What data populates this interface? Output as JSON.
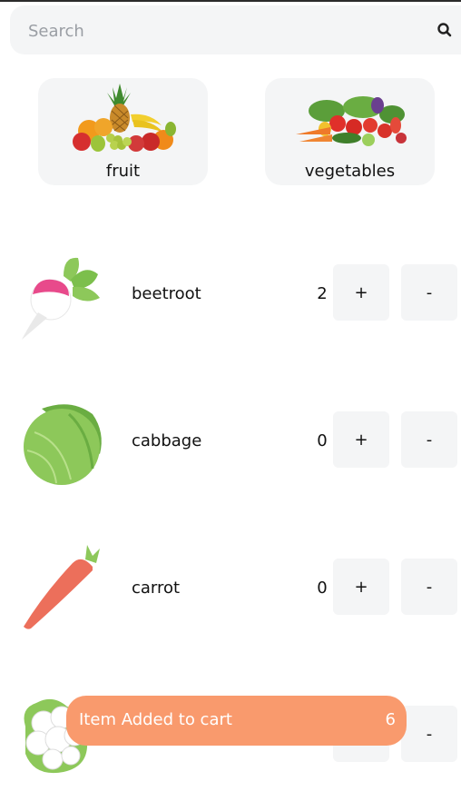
{
  "search": {
    "placeholder": "Search",
    "value": ""
  },
  "categories": [
    {
      "label": "fruit",
      "icon": "fruit-basket-image"
    },
    {
      "label": "vegetables",
      "icon": "vegetables-basket-image"
    }
  ],
  "items": [
    {
      "name": "beetroot",
      "qty": "2",
      "plus": "+",
      "minus": "-",
      "icon": "beetroot-image"
    },
    {
      "name": "cabbage",
      "qty": "0",
      "plus": "+",
      "minus": "-",
      "icon": "cabbage-image"
    },
    {
      "name": "carrot",
      "qty": "0",
      "plus": "+",
      "minus": "-",
      "icon": "carrot-image"
    },
    {
      "name": "",
      "qty": "",
      "plus": "",
      "minus": "-",
      "icon": "cauliflower-image"
    }
  ],
  "toast": {
    "text": "Item Added to cart",
    "count": "6"
  },
  "colors": {
    "toast": "#f99a6d",
    "card_bg": "#f4f5f6",
    "beet": "#e84a8b",
    "leaf": "#8dc85a",
    "carrot": "#ec6f5b"
  }
}
